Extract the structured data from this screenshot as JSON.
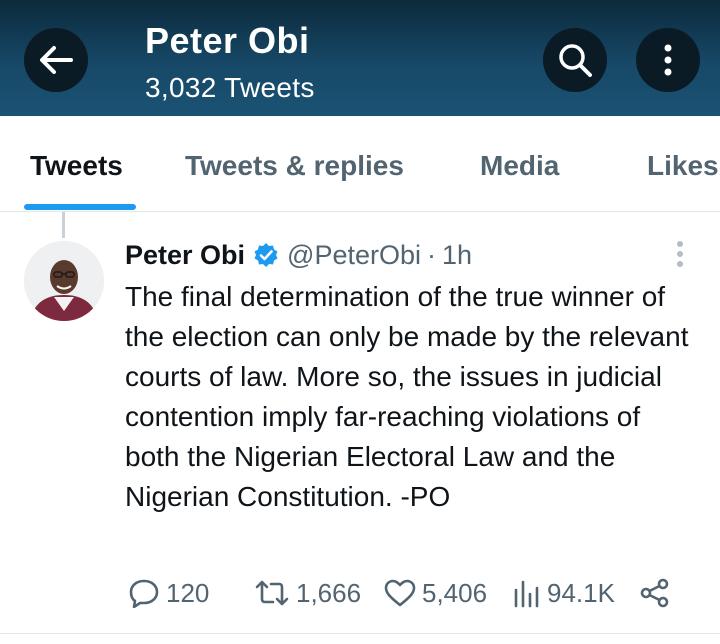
{
  "header": {
    "title": "Peter Obi",
    "subtitle": "3,032 Tweets",
    "back_icon": "arrow-left-icon",
    "search_icon": "search-icon",
    "more_icon": "more-vertical-icon"
  },
  "tabs": [
    {
      "label": "Tweets",
      "active": true
    },
    {
      "label": "Tweets & replies",
      "active": false
    },
    {
      "label": "Media",
      "active": false
    },
    {
      "label": "Likes",
      "active": false
    }
  ],
  "tweet": {
    "name": "Peter Obi",
    "handle": "@PeterObi",
    "separator": "·",
    "time": "1h",
    "text": "The final determination of the true winner of the election can only be made by the relevant courts of law. More so, the issues in judicial contention imply far-reaching violations of both the Nigerian Electoral Law and the Nigerian Constitution. -PO",
    "actions": {
      "replies": "120",
      "retweets": "1,666",
      "likes": "5,406",
      "views": "94.1K"
    }
  },
  "colors": {
    "accent": "#1d9bf0",
    "header_dark": "#0c2a3c",
    "header_light": "#1b5273",
    "text_primary": "#0f1419",
    "text_secondary": "#536471"
  }
}
